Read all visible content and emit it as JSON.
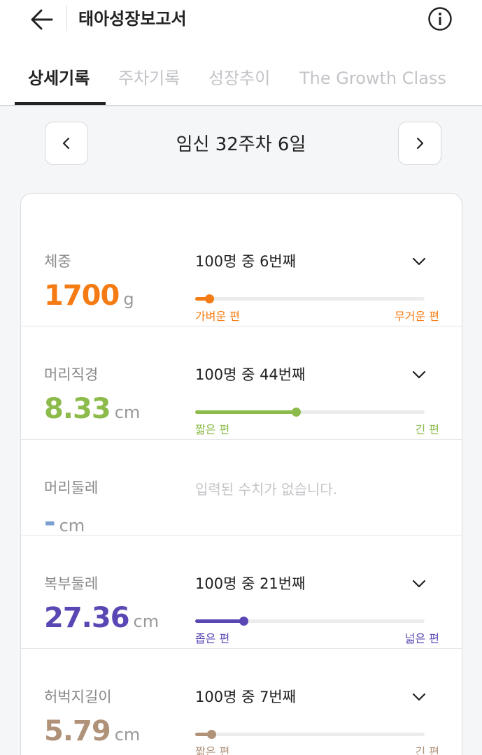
{
  "header": {
    "title": "태아성장보고서"
  },
  "tabs": [
    {
      "label": "상세기록",
      "active": true
    },
    {
      "label": "주차기록",
      "active": false
    },
    {
      "label": "성장추이",
      "active": false
    },
    {
      "label": "The Growth Class",
      "active": false
    }
  ],
  "date_nav": {
    "label": "임신 32주차 6일"
  },
  "measurements": [
    {
      "label": "체중",
      "value": "1700",
      "unit": "g",
      "rank": "100명 중 6번째",
      "percentile": 6,
      "left_label": "가벼운 편",
      "right_label": "무거운 편",
      "color": "#f57c14",
      "has_data": true
    },
    {
      "label": "머리직경",
      "value": "8.33",
      "unit": "cm",
      "rank": "100명 중 44번째",
      "percentile": 44,
      "left_label": "짧은 편",
      "right_label": "긴 편",
      "color": "#8cbb4c",
      "has_data": true
    },
    {
      "label": "머리둘레",
      "value": "-",
      "unit": "cm",
      "empty_message": "입력된 수치가 없습니다.",
      "color": "#7b9fd0",
      "has_data": false
    },
    {
      "label": "복부둘레",
      "value": "27.36",
      "unit": "cm",
      "rank": "100명 중 21번째",
      "percentile": 21,
      "left_label": "좁은 편",
      "right_label": "넓은 편",
      "color": "#5a47b3",
      "has_data": true
    },
    {
      "label": "허벅지길이",
      "value": "5.79",
      "unit": "cm",
      "rank": "100명 중 7번째",
      "percentile": 7,
      "left_label": "짧은 편",
      "right_label": "긴 편",
      "color": "#b09279",
      "has_data": true
    }
  ]
}
